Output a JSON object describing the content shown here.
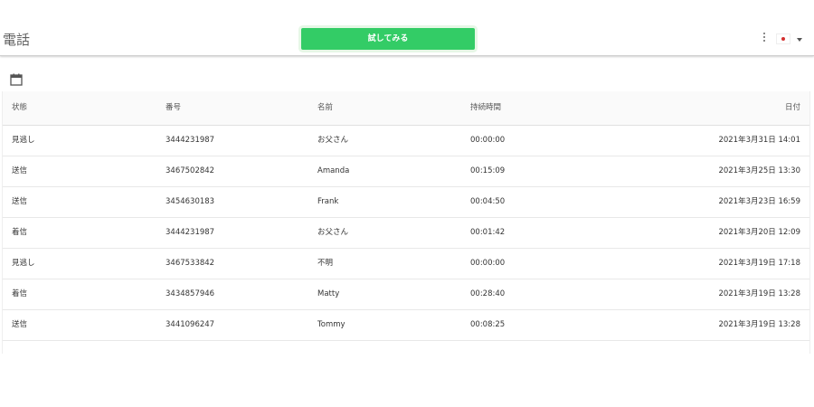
{
  "header": {
    "title": "電話",
    "try_button": "試してみる",
    "menu_icon": "more-vertical-icon",
    "language_icon": "japan-flag-icon",
    "dropdown_icon": "caret-down-icon"
  },
  "toolbar": {
    "calendar_icon": "calendar-icon"
  },
  "colors": {
    "accent": "#33cc66",
    "flag_red": "#d32f2f"
  },
  "table": {
    "headers": {
      "status": "状態",
      "number": "番号",
      "name": "名前",
      "duration": "持続時間",
      "date": "日付"
    },
    "rows": [
      {
        "status": "見逃し",
        "number": "3444231987",
        "name": "お父さん",
        "duration": "00:00:00",
        "date": "2021年3月31日 14:01"
      },
      {
        "status": "送信",
        "number": "3467502842",
        "name": "Amanda",
        "duration": "00:15:09",
        "date": "2021年3月25日 13:30"
      },
      {
        "status": "送信",
        "number": "3454630183",
        "name": "Frank",
        "duration": "00:04:50",
        "date": "2021年3月23日 16:59"
      },
      {
        "status": "着信",
        "number": "3444231987",
        "name": "お父さん",
        "duration": "00:01:42",
        "date": "2021年3月20日 12:09"
      },
      {
        "status": "見逃し",
        "number": "3467533842",
        "name": "不明",
        "duration": "00:00:00",
        "date": "2021年3月19日 17:18"
      },
      {
        "status": "着信",
        "number": "3434857946",
        "name": "Matty",
        "duration": "00:28:40",
        "date": "2021年3月19日 13:28"
      },
      {
        "status": "送信",
        "number": "3441096247",
        "name": "Tommy",
        "duration": "00:08:25",
        "date": "2021年3月19日 13:28"
      }
    ]
  }
}
